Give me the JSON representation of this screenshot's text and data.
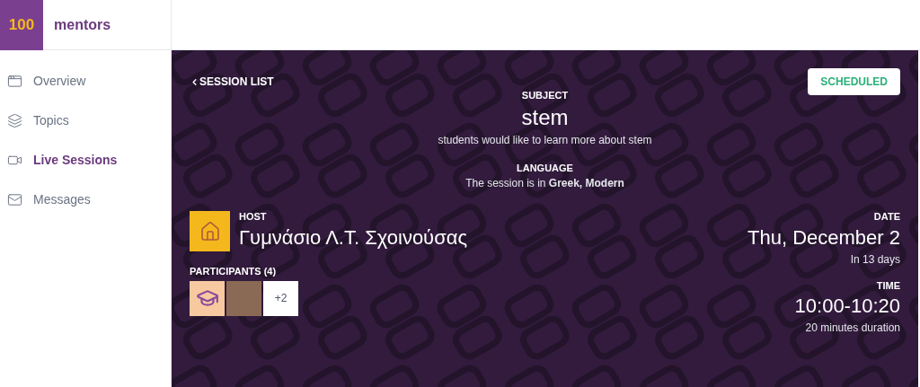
{
  "logo": {
    "mark": "100",
    "name": "mentors"
  },
  "sidebar": {
    "items": [
      {
        "label": "Overview",
        "selected": false
      },
      {
        "label": "Topics",
        "selected": false
      },
      {
        "label": "Live Sessions",
        "selected": true
      },
      {
        "label": "Messages",
        "selected": false
      }
    ]
  },
  "session": {
    "back_link": "SESSION LIST",
    "status": "SCHEDULED",
    "subject": {
      "heading": "SUBJECT",
      "title": "stem",
      "description": "students would like to learn more about stem"
    },
    "language": {
      "heading": "LANGUAGE",
      "text": "The session is in **Greek, Modern**"
    },
    "host": {
      "heading": "HOST",
      "name": "Γυμνάσιο Λ.Τ. Σχοινούσας"
    },
    "participants": {
      "heading": "PARTICIPANTS (4)",
      "more": "+2"
    },
    "date": {
      "heading": "DATE",
      "value": "Thu, December 2",
      "note": "In 13 days"
    },
    "time": {
      "heading": "TIME",
      "value": "10:00-10:20",
      "note": "20 minutes duration"
    }
  }
}
